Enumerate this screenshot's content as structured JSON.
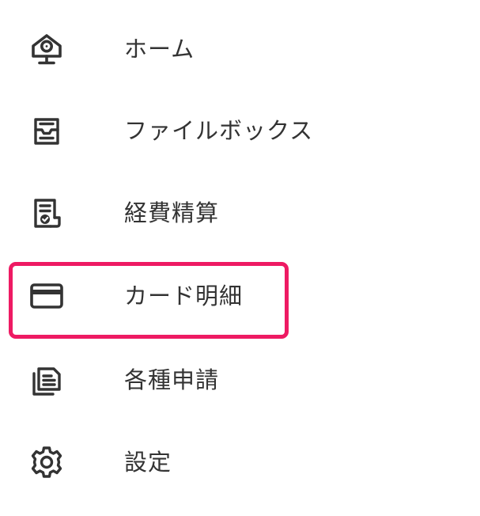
{
  "menu": {
    "items": [
      {
        "id": "home",
        "icon": "home-icon",
        "label": "ホーム"
      },
      {
        "id": "filebox",
        "icon": "inbox-tray-icon",
        "label": "ファイルボックス"
      },
      {
        "id": "expense",
        "icon": "receipt-check-icon",
        "label": "経費精算"
      },
      {
        "id": "card",
        "icon": "credit-card-icon",
        "label": "カード明細"
      },
      {
        "id": "requests",
        "icon": "documents-icon",
        "label": "各種申請"
      },
      {
        "id": "settings",
        "icon": "gear-icon",
        "label": "設定"
      }
    ]
  },
  "highlight": {
    "target": "card",
    "color": "#ee1a63"
  },
  "colors": {
    "text": "#333333",
    "icon": "#333333",
    "background": "#ffffff"
  }
}
